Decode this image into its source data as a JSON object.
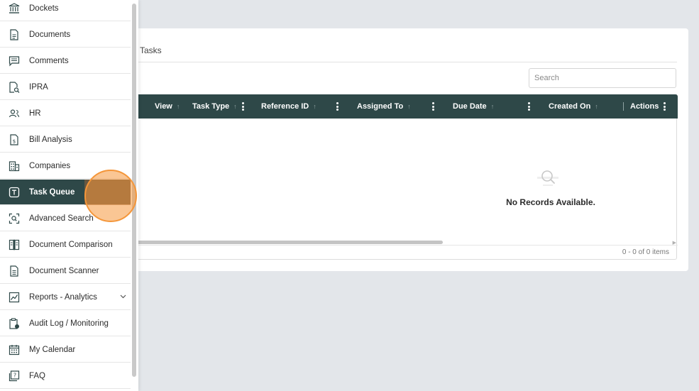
{
  "sidebar": {
    "items": [
      {
        "label": "Dockets",
        "icon": "bank-icon"
      },
      {
        "label": "Documents",
        "icon": "document-icon"
      },
      {
        "label": "Comments",
        "icon": "comment-icon"
      },
      {
        "label": "IPRA",
        "icon": "document-search-icon"
      },
      {
        "label": "HR",
        "icon": "people-icon"
      },
      {
        "label": "Bill Analysis",
        "icon": "bill-icon"
      },
      {
        "label": "Companies",
        "icon": "building-icon"
      },
      {
        "label": "Task Queue",
        "icon": "task-icon",
        "active": true
      },
      {
        "label": "Advanced Search",
        "icon": "scan-search-icon"
      },
      {
        "label": "Document Comparison",
        "icon": "compare-icon"
      },
      {
        "label": "Document Scanner",
        "icon": "scanner-document-icon"
      },
      {
        "label": "Reports - Analytics",
        "icon": "chart-icon",
        "expandable": true
      },
      {
        "label": "Audit Log / Monitoring",
        "icon": "clipboard-monitor-icon"
      },
      {
        "label": "My Calendar",
        "icon": "calendar-icon"
      },
      {
        "label": "FAQ",
        "icon": "faq-icon"
      }
    ]
  },
  "main": {
    "tab_label": "Tasks",
    "search_placeholder": "Search",
    "columns": [
      "View",
      "Task Type",
      "Reference ID",
      "Assigned To",
      "Due Date",
      "Created On",
      "Actions"
    ],
    "empty_message": "No Records Available.",
    "pager_info": "0 - 0 of 0 items"
  },
  "colors": {
    "accent": "#2e4848",
    "background": "#e3e6ea",
    "click_marker": "#f4963a"
  }
}
